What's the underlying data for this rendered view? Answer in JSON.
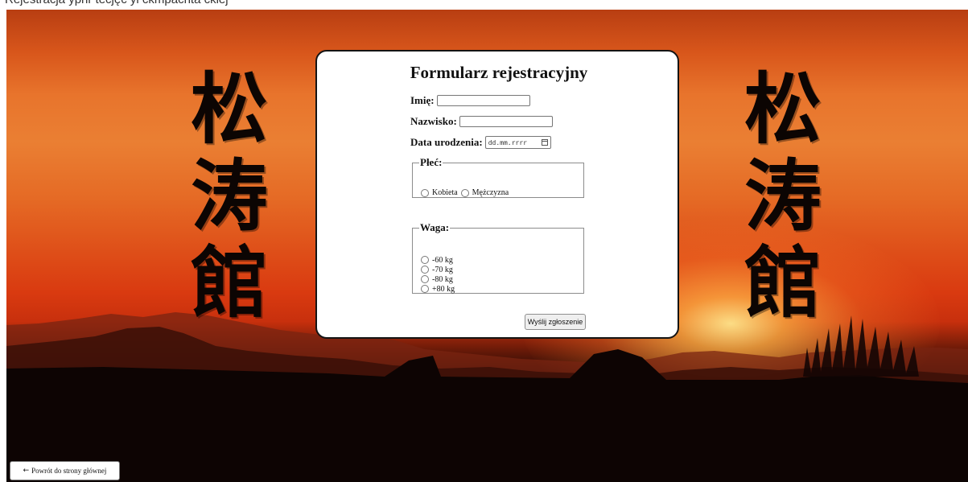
{
  "top_strip": {
    "text": "Rejestracja ypnr tecjęc yi ckmpacnta cklej"
  },
  "banner": {
    "kanji_left": [
      "松",
      "涛",
      "館"
    ],
    "kanji_right": [
      "松",
      "涛",
      "館"
    ]
  },
  "form": {
    "title": "Formularz rejestracyjny",
    "first_name": {
      "label": "Imię:",
      "value": "",
      "placeholder": ""
    },
    "last_name": {
      "label": "Nazwisko:",
      "value": "",
      "placeholder": ""
    },
    "birth_date": {
      "label": "Data urodzenia:",
      "placeholder": "dd.mm.rrrr"
    },
    "gender": {
      "legend": "Płeć:",
      "options": [
        {
          "label": "Kobieta",
          "checked": false
        },
        {
          "label": "Mężczyzna",
          "checked": false
        }
      ]
    },
    "weight": {
      "legend": "Waga:",
      "options": [
        {
          "label": "-60 kg",
          "checked": false
        },
        {
          "label": "-70 kg",
          "checked": false
        },
        {
          "label": "-80 kg",
          "checked": false
        },
        {
          "label": "+80 kg",
          "checked": false
        }
      ]
    },
    "submit_label": "Wyślij zgłoszenie"
  },
  "back_button": {
    "arrow": "←",
    "label": "Powrót do strony głównej"
  },
  "colors": {
    "card_border": "#141414",
    "sky_top": "#b83e12",
    "sky_mid": "#ea7f33",
    "horizon": "#d93a10",
    "ground": "#050202"
  }
}
